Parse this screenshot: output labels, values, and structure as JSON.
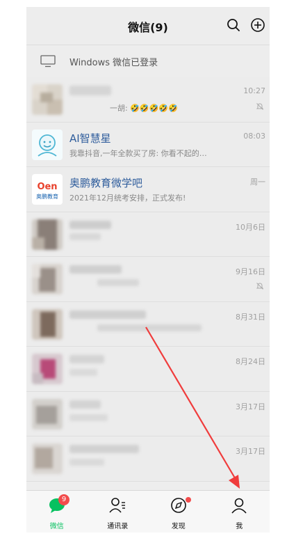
{
  "header": {
    "title": "微信(9)",
    "search_icon": "search-icon",
    "add_icon": "plus-circle-icon"
  },
  "login_banner": {
    "text": "Windows 微信已登录",
    "icon": "monitor-icon"
  },
  "chats": [
    {
      "name": "",
      "preview": "一胡: 🤣🤣🤣🤣🤣",
      "time": "10:27",
      "muted": true
    },
    {
      "name": "AI智慧星",
      "preview": "我靠抖音,一年全款买了房: 你看不起的…",
      "time": "08:03",
      "muted": false
    },
    {
      "name": "奥鹏教育微学吧",
      "preview": "2021年12月统考安排，正式发布!",
      "time": "周一",
      "muted": false
    },
    {
      "name": "",
      "preview": "",
      "time": "10月6日",
      "muted": false
    },
    {
      "name": "",
      "preview": "",
      "time": "9月16日",
      "muted": true
    },
    {
      "name": "",
      "preview": "",
      "time": "8月31日",
      "muted": false
    },
    {
      "name": "",
      "preview": "",
      "time": "8月24日",
      "muted": false
    },
    {
      "name": "",
      "preview": "",
      "time": "3月17日",
      "muted": false
    },
    {
      "name": "",
      "preview": "",
      "time": "3月17日",
      "muted": false
    }
  ],
  "logos": {
    "aopeng_top": "Oen",
    "aopeng_bottom": "奥鹏教育"
  },
  "tabs": [
    {
      "label": "微信",
      "icon": "chat-bubble-icon",
      "badge": "9",
      "active": true
    },
    {
      "label": "通讯录",
      "icon": "contacts-icon",
      "badge": "",
      "active": false
    },
    {
      "label": "发现",
      "icon": "compass-icon",
      "badge": "",
      "active": false
    },
    {
      "label": "我",
      "icon": "person-icon",
      "badge": "",
      "active": false
    }
  ],
  "colors": {
    "accent": "#07c160",
    "badge": "#f24c4c",
    "arrow": "#f03c3c",
    "bg": "#ededed"
  }
}
